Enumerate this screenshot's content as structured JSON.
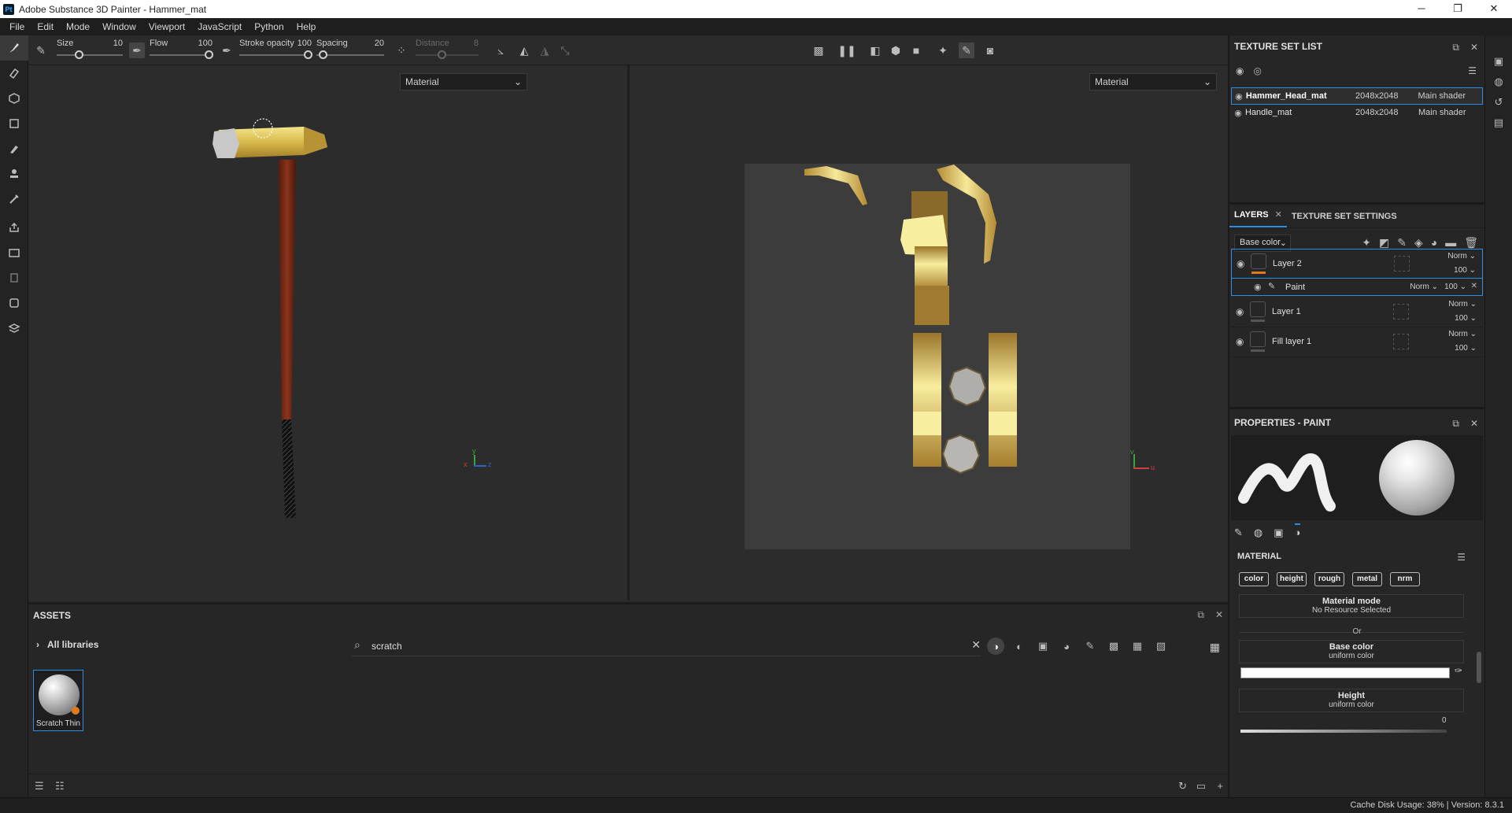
{
  "window": {
    "title": "Adobe Substance 3D Painter - Hammer_mat",
    "app_badge": "Pt"
  },
  "menu": [
    "File",
    "Edit",
    "Mode",
    "Window",
    "Viewport",
    "JavaScript",
    "Python",
    "Help"
  ],
  "toolbar": {
    "size": {
      "label": "Size",
      "value": "10"
    },
    "flow": {
      "label": "Flow",
      "value": "100"
    },
    "stroke_opacity": {
      "label": "Stroke opacity",
      "value": "100"
    },
    "spacing": {
      "label": "Spacing",
      "value": "20"
    },
    "distance": {
      "label": "Distance",
      "value": "8"
    }
  },
  "viewport3d": {
    "mode": "Material",
    "axes": {
      "y": "y",
      "x": "x",
      "z": "z"
    }
  },
  "viewport2d": {
    "mode": "Material",
    "axes": {
      "v": "v",
      "u": "u"
    }
  },
  "assets": {
    "title": "ASSETS",
    "library": "All libraries",
    "search_query": "scratch",
    "items": [
      {
        "name": "Scratch Thin"
      }
    ]
  },
  "texture_set_list": {
    "title": "TEXTURE SET LIST",
    "sets": [
      {
        "name": "Hammer_Head_mat",
        "resolution": "2048x2048",
        "shader": "Main shader",
        "selected": true
      },
      {
        "name": "Handle_mat",
        "resolution": "2048x2048",
        "shader": "Main shader",
        "selected": false
      }
    ]
  },
  "layers": {
    "tabs": [
      "LAYERS",
      "TEXTURE SET SETTINGS"
    ],
    "channel": "Base color",
    "items": [
      {
        "name": "Layer 2",
        "blend": "Norm",
        "opacity": "100",
        "selected": true,
        "effect": {
          "name": "Paint",
          "blend": "Norm",
          "opacity": "100"
        }
      },
      {
        "name": "Layer 1",
        "blend": "Norm",
        "opacity": "100"
      },
      {
        "name": "Fill layer 1",
        "blend": "Norm",
        "opacity": "100"
      }
    ]
  },
  "properties": {
    "title": "PROPERTIES - PAINT",
    "section": "MATERIAL",
    "channels": [
      "color",
      "height",
      "rough",
      "metal",
      "nrm"
    ],
    "material_mode": {
      "title": "Material mode",
      "value": "No Resource Selected"
    },
    "or_label": "Or",
    "base_color": {
      "title": "Base color",
      "value": "uniform color",
      "color": "#ffffff"
    },
    "height": {
      "title": "Height",
      "value": "uniform color",
      "amount": "0"
    }
  },
  "status": {
    "cache": "Cache Disk Usage:",
    "cache_pct": "38%",
    "version": "Version: 8.3.1"
  },
  "colors": {
    "accent": "#2f8cdf",
    "orange": "#e07b22",
    "gold": "#c9a33a"
  }
}
